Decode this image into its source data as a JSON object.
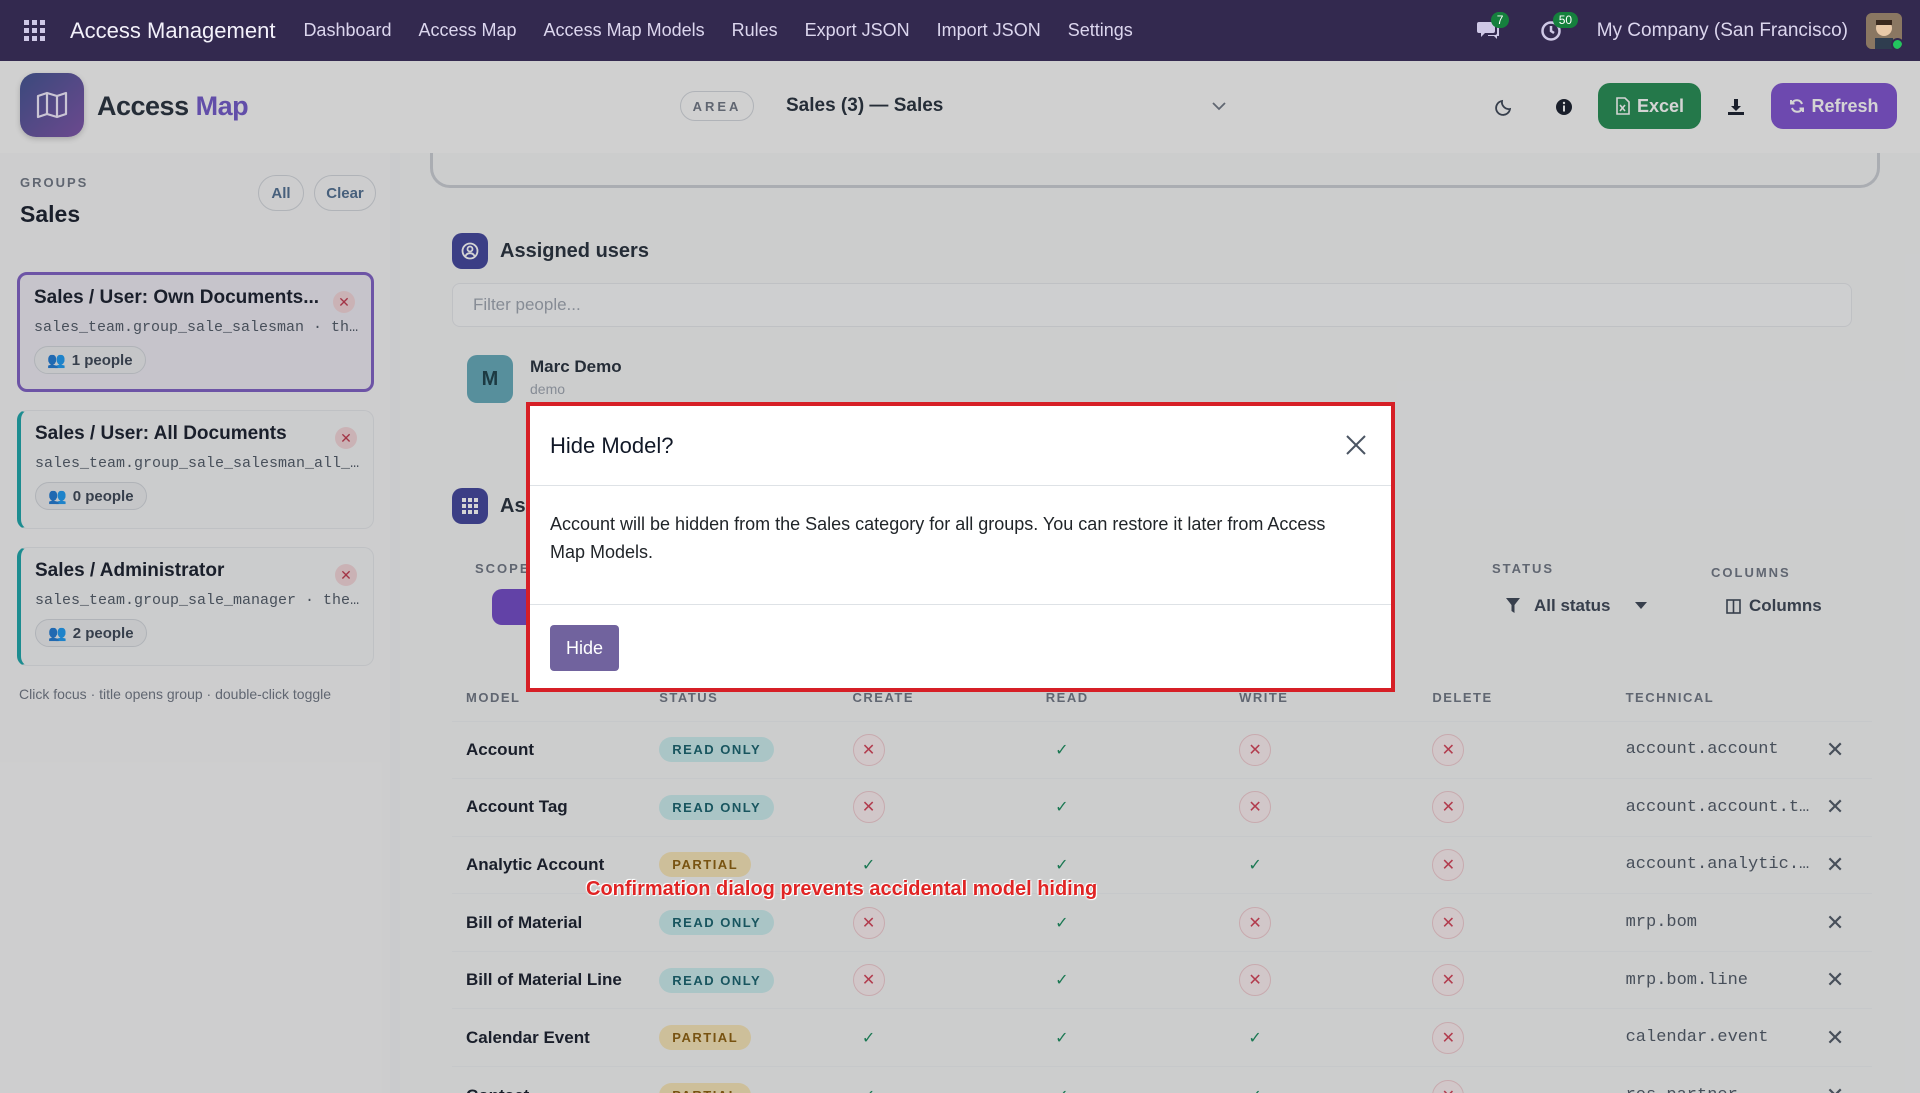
{
  "topnav": {
    "brand": "Access Management",
    "menu": [
      "Dashboard",
      "Access Map",
      "Access Map Models",
      "Rules",
      "Export JSON",
      "Import JSON",
      "Settings"
    ],
    "messages_count": "7",
    "activities_count": "50",
    "company": "My Company (San Francisco)"
  },
  "header": {
    "title_part1": "Access",
    "title_part2": "Map",
    "area_label": "AREA",
    "area_value": "Sales (3) — Sales",
    "excel_label": "Excel",
    "refresh_label": "Refresh"
  },
  "sidebar": {
    "groups_label": "GROUPS",
    "title": "Sales",
    "all_label": "All",
    "clear_label": "Clear",
    "groups": [
      {
        "title": "Sales / User: Own Documents...",
        "tech": "sales_team.group_sale_salesman · the…",
        "people": "1 people"
      },
      {
        "title": "Sales / User: All Documents",
        "tech": "sales_team.group_sale_salesman_all_l…",
        "people": "0 people"
      },
      {
        "title": "Sales / Administrator",
        "tech": "sales_team.group_sale_manager · the …",
        "people": "2 people"
      }
    ],
    "hint": "Click focus · title opens group · double-click toggle"
  },
  "main": {
    "assigned_users_title": "Assigned users",
    "filter_placeholder": "Filter people...",
    "user_name": "Marc Demo",
    "user_initial": "M",
    "user_sub": "demo",
    "second_section_title": "As",
    "scope_label": "SCOPE",
    "status_label": "STATUS",
    "status_value": "All status",
    "columns_label": "COLUMNS",
    "columns_button": "Columns",
    "table_headers": [
      "MODEL",
      "STATUS",
      "CREATE",
      "READ",
      "WRITE",
      "DELETE",
      "TECHNICAL"
    ],
    "rows": [
      {
        "model": "Account",
        "status": "READ ONLY",
        "c": "no",
        "r": "yes",
        "w": "no",
        "d": "no",
        "tech": "account.account"
      },
      {
        "model": "Account Tag",
        "status": "READ ONLY",
        "c": "no",
        "r": "yes",
        "w": "no",
        "d": "no",
        "tech": "account.account.t…"
      },
      {
        "model": "Analytic Account",
        "status": "PARTIAL",
        "c": "yes",
        "r": "yes",
        "w": "yes",
        "d": "no",
        "tech": "account.analytic.…"
      },
      {
        "model": "Bill of Material",
        "status": "READ ONLY",
        "c": "no",
        "r": "yes",
        "w": "no",
        "d": "no",
        "tech": "mrp.bom"
      },
      {
        "model": "Bill of Material Line",
        "status": "READ ONLY",
        "c": "no",
        "r": "yes",
        "w": "no",
        "d": "no",
        "tech": "mrp.bom.line"
      },
      {
        "model": "Calendar Event",
        "status": "PARTIAL",
        "c": "yes",
        "r": "yes",
        "w": "yes",
        "d": "no",
        "tech": "calendar.event"
      },
      {
        "model": "Contact",
        "status": "PARTIAL",
        "c": "yes",
        "r": "yes",
        "w": "yes",
        "d": "no",
        "tech": "res.partner"
      }
    ]
  },
  "modal": {
    "title": "Hide Model?",
    "body": "Account will be hidden from the Sales category for all groups. You can restore it later from Access Map Models.",
    "hide_label": "Hide"
  },
  "caption": "Confirmation dialog prevents accidental model hiding",
  "colors": {
    "nav": "#33294f",
    "accent": "#7b4ed0",
    "excel": "#1e8a4f",
    "danger": "#d61f26"
  }
}
